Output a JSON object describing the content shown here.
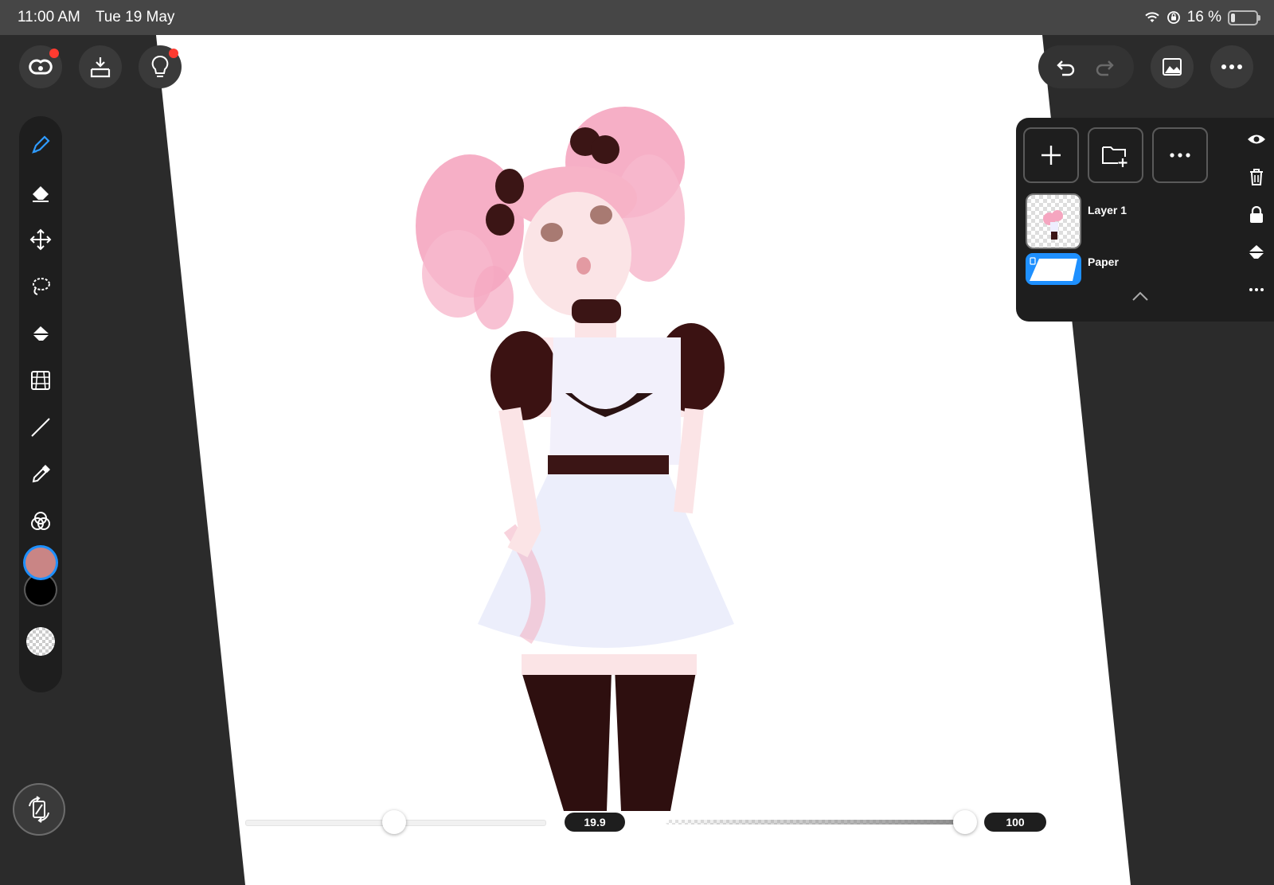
{
  "status_bar": {
    "time": "11:00 AM",
    "date": "Tue 19 May",
    "battery": "16 %"
  },
  "layers": {
    "items": [
      {
        "name": "Layer 1"
      },
      {
        "name": "Paper"
      }
    ]
  },
  "sliders": {
    "brush_size": {
      "label": "19.9",
      "value": 19.9
    },
    "opacity": {
      "label": "100",
      "value": 100
    }
  },
  "colors": {
    "primary": "#c98585",
    "secondary": "#000000",
    "accent_blue": "#1e90ff",
    "panel": "#1e1e1e",
    "background": "#2b2b2b",
    "canvas": "#ffffff"
  },
  "icons": {
    "top_left": [
      "creative-cloud-icon",
      "import-icon",
      "lightbulb-icon"
    ],
    "top_right": [
      "undo-icon",
      "redo-icon",
      "layers-icon",
      "more-icon"
    ],
    "tools": [
      "brush-icon",
      "eraser-icon",
      "move-icon",
      "lasso-icon",
      "fill-icon",
      "perspective-grid-icon",
      "line-icon",
      "eyedropper-icon",
      "blend-icon"
    ],
    "layer_actions": [
      "eye-icon",
      "trash-icon",
      "lock-icon",
      "fill-icon",
      "more-icon"
    ]
  }
}
